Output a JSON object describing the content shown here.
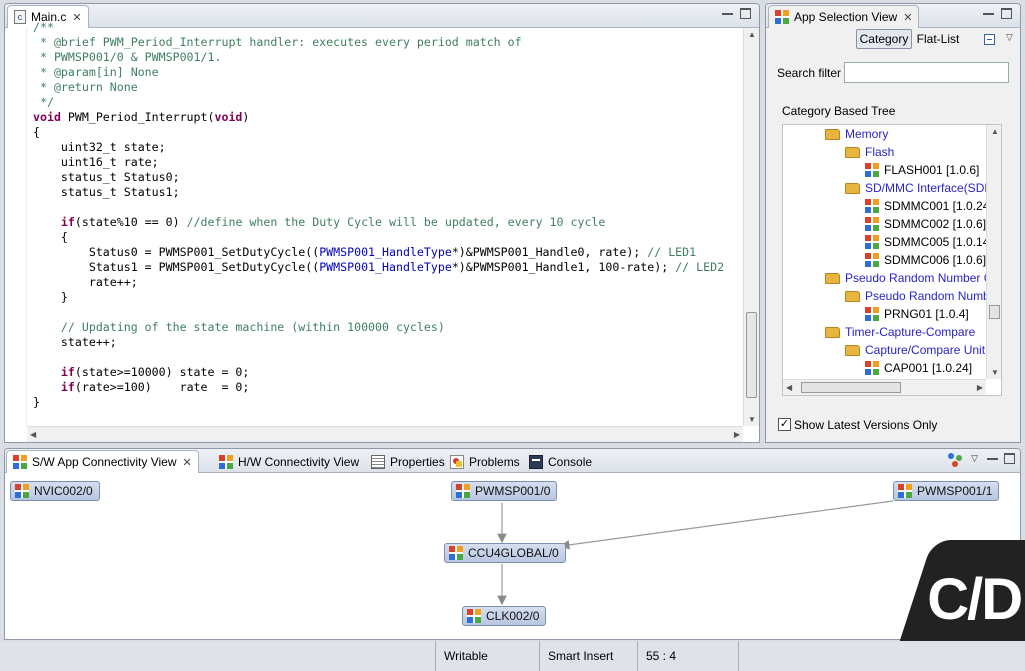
{
  "editor": {
    "tab_label": "Main.c",
    "code_lines": [
      [
        {
          "t": "/**",
          "c": "cm"
        }
      ],
      [
        {
          "t": " * @brief PWM_Period_Interrupt handler: executes every period match of",
          "c": "cm"
        }
      ],
      [
        {
          "t": " * PWMSP001/0 & PWMSP001/1.",
          "c": "cm"
        }
      ],
      [
        {
          "t": " * @param[in] None",
          "c": "cm"
        }
      ],
      [
        {
          "t": " * @return None",
          "c": "cm"
        }
      ],
      [
        {
          "t": " */",
          "c": "cm"
        }
      ],
      [
        {
          "t": "void",
          "c": "kw"
        },
        {
          "t": " PWM_Period_Interrupt(",
          "c": ""
        },
        {
          "t": "void",
          "c": "kw"
        },
        {
          "t": ")",
          "c": ""
        }
      ],
      [
        {
          "t": "{",
          "c": ""
        }
      ],
      [
        {
          "t": "    uint32_t state;",
          "c": ""
        }
      ],
      [
        {
          "t": "    uint16_t rate;",
          "c": ""
        }
      ],
      [
        {
          "t": "    status_t Status0;",
          "c": ""
        }
      ],
      [
        {
          "t": "    status_t Status1;",
          "c": ""
        }
      ],
      [
        {
          "t": "",
          "c": ""
        }
      ],
      [
        {
          "t": "    ",
          "c": ""
        },
        {
          "t": "if",
          "c": "kw"
        },
        {
          "t": "(state%10 == 0) ",
          "c": ""
        },
        {
          "t": "//define when the Duty Cycle will be updated, every 10 cycle",
          "c": "cm"
        }
      ],
      [
        {
          "t": "    {",
          "c": ""
        }
      ],
      [
        {
          "t": "        Status0 = PWMSP001_SetDutyCycle((",
          "c": ""
        },
        {
          "t": "PWMSP001_HandleType",
          "c": "ty"
        },
        {
          "t": "*)&PWMSP001_Handle0, rate); ",
          "c": ""
        },
        {
          "t": "// LED1",
          "c": "cm"
        }
      ],
      [
        {
          "t": "        Status1 = PWMSP001_SetDutyCycle((",
          "c": ""
        },
        {
          "t": "PWMSP001_HandleType",
          "c": "ty"
        },
        {
          "t": "*)&PWMSP001_Handle1, 100-rate); ",
          "c": ""
        },
        {
          "t": "// LED2",
          "c": "cm"
        }
      ],
      [
        {
          "t": "        rate++;",
          "c": ""
        }
      ],
      [
        {
          "t": "    }",
          "c": ""
        }
      ],
      [
        {
          "t": "",
          "c": ""
        }
      ],
      [
        {
          "t": "    ",
          "c": ""
        },
        {
          "t": "// Updating of the state machine (within 100000 cycles)",
          "c": "cm"
        }
      ],
      [
        {
          "t": "    state++;",
          "c": ""
        }
      ],
      [
        {
          "t": "",
          "c": ""
        }
      ],
      [
        {
          "t": "    ",
          "c": ""
        },
        {
          "t": "if",
          "c": "kw"
        },
        {
          "t": "(state>=10000) state = 0;",
          "c": ""
        }
      ],
      [
        {
          "t": "    ",
          "c": ""
        },
        {
          "t": "if",
          "c": "kw"
        },
        {
          "t": "(rate>=100)    rate  = 0;",
          "c": ""
        }
      ],
      [
        {
          "t": "}",
          "c": ""
        }
      ]
    ]
  },
  "app_selection": {
    "tab_label": "App Selection View",
    "category_button": "Category",
    "flatlist_button": "Flat-List",
    "search_label": "Search filter",
    "search_value": "",
    "tree_label": "Category Based Tree",
    "tree": [
      {
        "label": "Memory",
        "kind": "folder",
        "link": true,
        "indent": 0
      },
      {
        "label": "Flash",
        "kind": "folder",
        "link": true,
        "indent": 1
      },
      {
        "label": "FLASH001 [1.0.6]",
        "kind": "app",
        "link": false,
        "indent": 2
      },
      {
        "label": "SD/MMC Interface(SDM",
        "kind": "folder",
        "link": true,
        "indent": 1
      },
      {
        "label": "SDMMC001 [1.0.24]",
        "kind": "app",
        "link": false,
        "indent": 2
      },
      {
        "label": "SDMMC002 [1.0.6]",
        "kind": "app",
        "link": false,
        "indent": 2
      },
      {
        "label": "SDMMC005 [1.0.14]",
        "kind": "app",
        "link": false,
        "indent": 2
      },
      {
        "label": "SDMMC006 [1.0.6]",
        "kind": "app",
        "link": false,
        "indent": 2
      },
      {
        "label": "Pseudo Random Number G",
        "kind": "folder",
        "link": true,
        "indent": 0
      },
      {
        "label": "Pseudo Random Numb",
        "kind": "folder",
        "link": true,
        "indent": 1
      },
      {
        "label": "PRNG01 [1.0.4]",
        "kind": "app",
        "link": false,
        "indent": 2
      },
      {
        "label": "Timer-Capture-Compare",
        "kind": "folder",
        "link": true,
        "indent": 0
      },
      {
        "label": "Capture/Compare Unit",
        "kind": "folder",
        "link": true,
        "indent": 1
      },
      {
        "label": "CAP001 [1.0.24]",
        "kind": "app",
        "link": false,
        "indent": 2
      }
    ],
    "show_latest_label": "Show Latest Versions Only",
    "show_latest_checked": true
  },
  "bottom_tabs": {
    "sw_app": "S/W App Connectivity View",
    "hw": "H/W Connectivity View",
    "properties": "Properties",
    "problems": "Problems",
    "console": "Console"
  },
  "graph": {
    "nvic": "NVIC002/0",
    "pwm0": "PWMSP001/0",
    "pwm1": "PWMSP001/1",
    "ccu4": "CCU4GLOBAL/0",
    "clk": "CLK002/0"
  },
  "logo_text": "C/D",
  "statusbar": {
    "writable": "Writable",
    "insert_mode": "Smart Insert",
    "position": "55 : 4"
  },
  "colors": {
    "accent_link": "#2a23c8",
    "comment": "#3f7f5f",
    "keyword": "#7f0055"
  }
}
